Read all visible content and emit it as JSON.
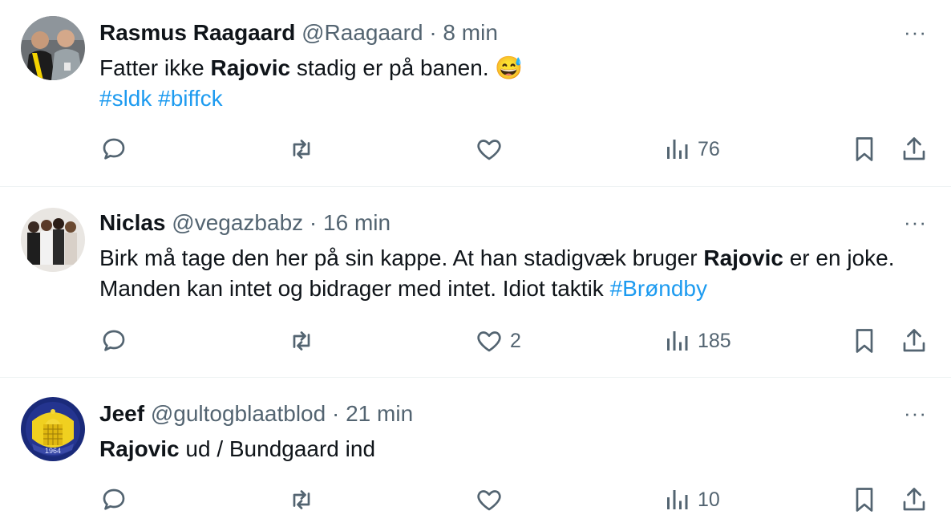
{
  "tweets": [
    {
      "name": "Rasmus Raagaard",
      "handle": "@Raagaard",
      "separator": "·",
      "time": "8 min",
      "text_pre": "Fatter ikke ",
      "text_bold": "Rajovic",
      "text_post": " stadig er på banen. ",
      "emoji": "😅",
      "hashtag1": "#sldk",
      "hashtag2": "#biffck",
      "likes": "",
      "views": "76",
      "avatar_icon": "avatar-photo-two-men"
    },
    {
      "name": "Niclas",
      "handle": "@vegazbabz",
      "separator": "·",
      "time": "16 min",
      "text_pre": "Birk må tage den her på sin kappe. At han stadigvæk bruger ",
      "text_bold": "Rajovic",
      "text_post": " er en joke. Manden kan intet og bidrager med intet. Idiot taktik ",
      "hashtag1": "#Brøndby",
      "likes": "2",
      "views": "185",
      "avatar_icon": "avatar-photo-group"
    },
    {
      "name": "Jeef",
      "handle": "@gultogblaatblod",
      "separator": "·",
      "time": "21 min",
      "text_bold": "Rajovic",
      "text_post": " ud / Bundgaard ind",
      "likes": "",
      "views": "10",
      "avatar_icon": "club-crest-1964",
      "crest_year": "1964"
    }
  ],
  "more_label": "···",
  "colors": {
    "text": "#0f1419",
    "secondary": "#536471",
    "link": "#1d9bf0",
    "divider": "#eff3f4"
  }
}
